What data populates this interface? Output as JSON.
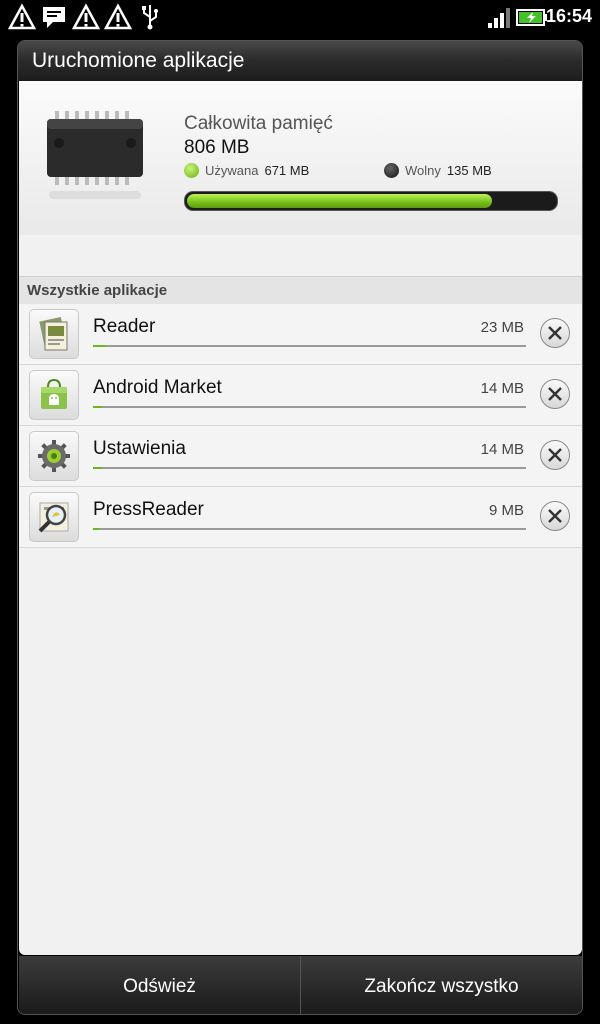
{
  "status_bar": {
    "icons": [
      "warning-icon",
      "message-icon",
      "warning-icon",
      "warning-icon",
      "usb-icon",
      "signal-icon",
      "battery-charging-icon"
    ],
    "time": "16:54"
  },
  "dialog": {
    "title": "Uruchomione aplikacje",
    "memory": {
      "label": "Całkowita pamięć",
      "total": "806 MB",
      "used_label": "Używana",
      "used_value": "671 MB",
      "free_label": "Wolny",
      "free_value": "135 MB",
      "used_fraction": 0.83,
      "used_color": "#7ac21c",
      "free_color": "#222222"
    },
    "section_header": "Wszystkie aplikacje",
    "apps": [
      {
        "name": "Reader",
        "size": "23 MB",
        "icon": "reader-icon",
        "usage_fraction": 0.03
      },
      {
        "name": "Android Market",
        "size": "14 MB",
        "icon": "market-icon",
        "usage_fraction": 0.02
      },
      {
        "name": "Ustawienia",
        "size": "14 MB",
        "icon": "settings-gear-icon",
        "usage_fraction": 0.02
      },
      {
        "name": "PressReader",
        "size": "9 MB",
        "icon": "pressreader-icon",
        "usage_fraction": 0.015
      }
    ],
    "buttons": {
      "refresh": "Odśwież",
      "end_all": "Zakończ wszystko"
    }
  }
}
